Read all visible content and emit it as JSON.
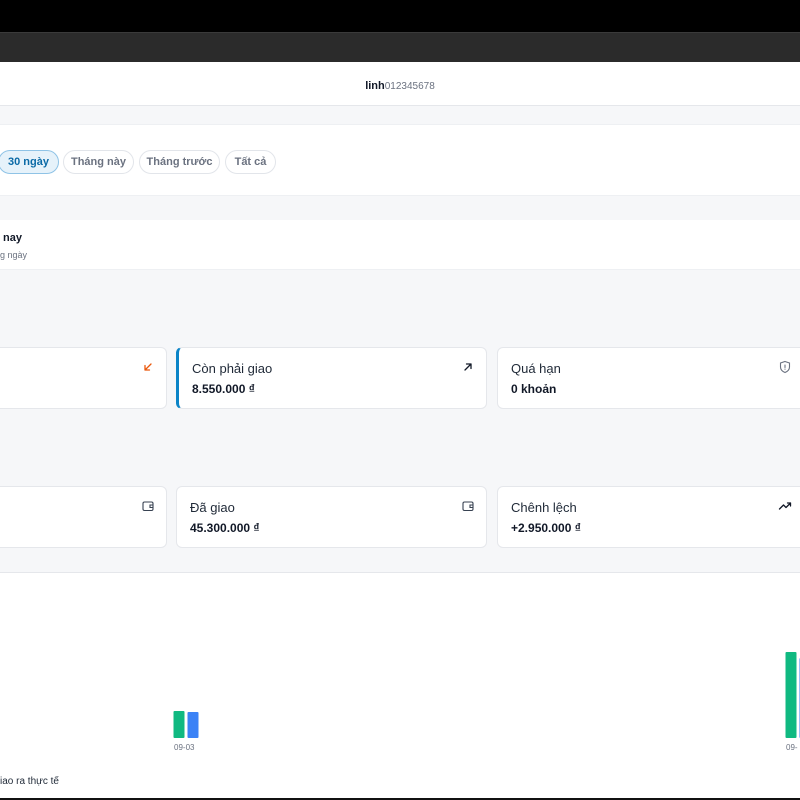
{
  "header": {
    "user_name": "linh",
    "user_phone": "012345678"
  },
  "filters": [
    {
      "label": "30 ngày",
      "active": true
    },
    {
      "label": "Tháng này",
      "active": false
    },
    {
      "label": "Tháng trước",
      "active": false
    },
    {
      "label": "Tất cả",
      "active": false
    }
  ],
  "section": {
    "heading": "nay",
    "subtitle": "g ngày"
  },
  "cards_row1": [
    {
      "label": "",
      "value": "",
      "icon": "arrow-down-left-icon",
      "icon_color": "#ea580c"
    },
    {
      "label": "Còn phải giao",
      "value": "8.550.000 ₫",
      "icon": "arrow-up-right-icon"
    },
    {
      "label": "Quá hạn",
      "value": "0 khoản",
      "icon": "shield-icon"
    }
  ],
  "cards_row2": [
    {
      "label": "",
      "value": "",
      "icon": "wallet-icon"
    },
    {
      "label": "Đã giao",
      "value": "45.300.000 ₫",
      "icon": "wallet-icon"
    },
    {
      "label": "Chênh lệch",
      "value": "+2.950.000 ₫",
      "icon": "trending-up-icon"
    }
  ],
  "chart_data": {
    "type": "bar",
    "categories": [
      "09-03",
      "09-"
    ],
    "series": [
      {
        "name": "",
        "color": "#10b981",
        "values": [
          27,
          86
        ]
      },
      {
        "name": "",
        "color": "#3b82f6",
        "values": [
          26,
          80
        ]
      }
    ],
    "legend_text": "iao ra thực tế",
    "ylim": [
      0,
      100
    ]
  }
}
